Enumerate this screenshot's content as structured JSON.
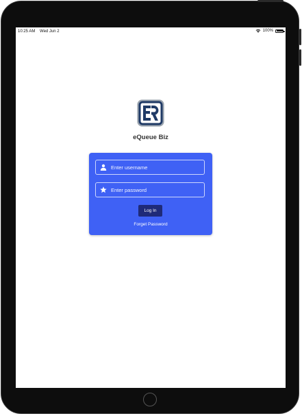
{
  "status_bar": {
    "time": "10:25 AM",
    "date": "Wed Jun 2",
    "battery_text": "100%",
    "battery_level": 1.0
  },
  "app": {
    "name": "eQueue Biz",
    "logo_icon": "equeue-logo-icon",
    "brand_color": "#3f61f5"
  },
  "login": {
    "username_placeholder": "Enter username",
    "password_placeholder": "Enter password",
    "login_label": "Log In",
    "forget_password_label": "Forget Password",
    "button_color": "#1f2a78"
  }
}
